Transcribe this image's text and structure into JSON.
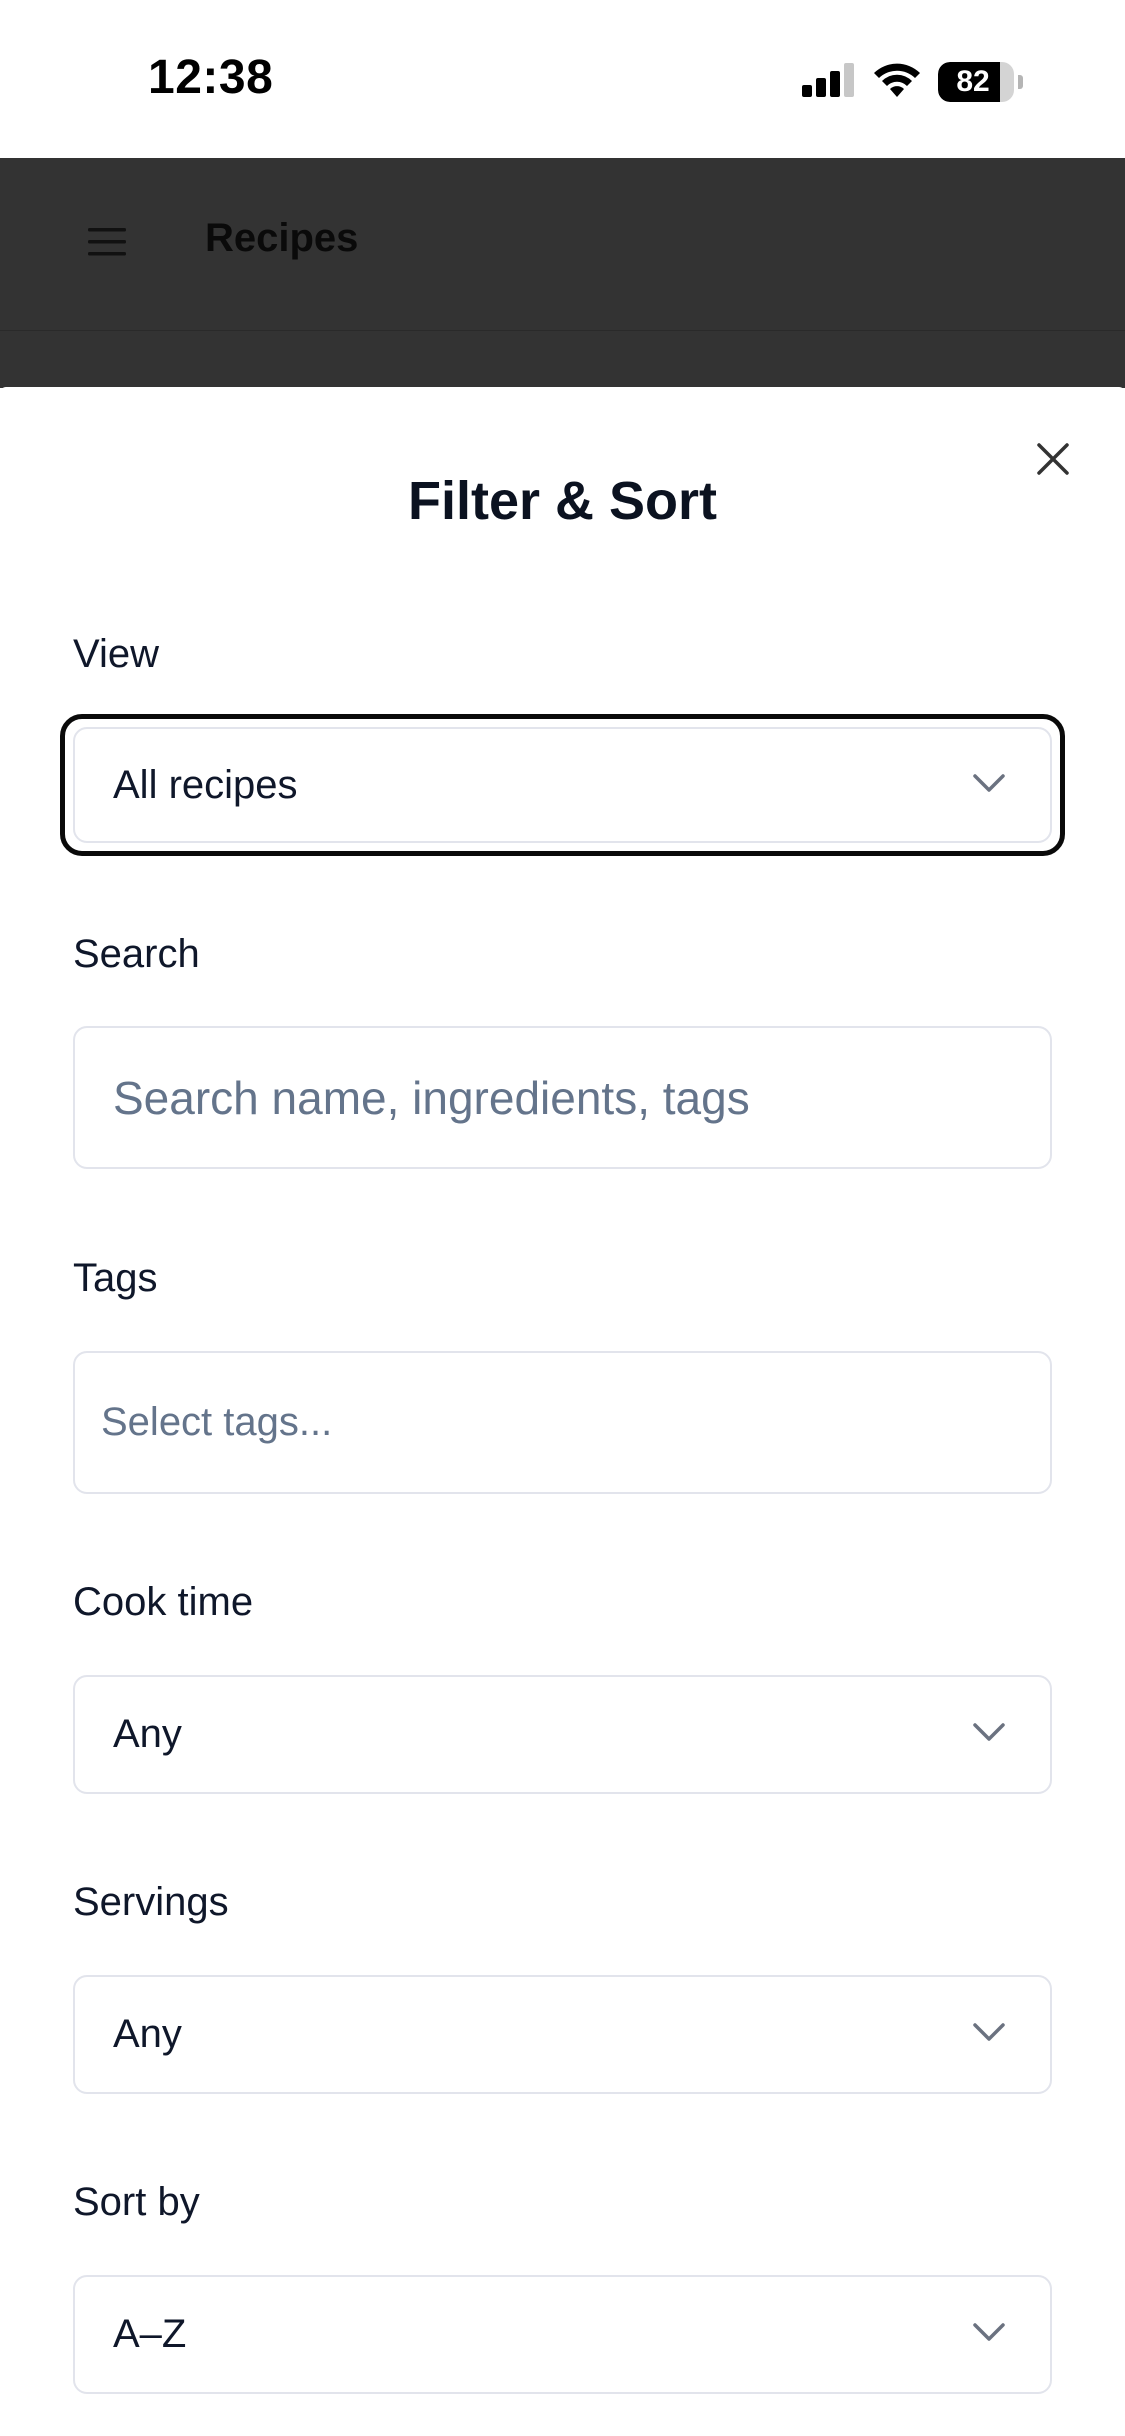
{
  "status_bar": {
    "time": "12:38",
    "battery_percent": 82,
    "icons": [
      "cellular-signal-icon",
      "wifi-icon",
      "battery-icon"
    ]
  },
  "app_header": {
    "menu_icon": "hamburger-menu-icon",
    "title": "Recipes"
  },
  "sheet": {
    "title": "Filter & Sort",
    "close_icon": "close-icon",
    "view": {
      "label": "View",
      "selected": "All recipes"
    },
    "search": {
      "label": "Search",
      "placeholder": "Search name, ingredients, tags",
      "value": ""
    },
    "tags": {
      "label": "Tags",
      "placeholder": "Select tags..."
    },
    "cook_time": {
      "label": "Cook time",
      "selected": "Any"
    },
    "servings": {
      "label": "Servings",
      "selected": "Any"
    },
    "sort_by": {
      "label": "Sort by",
      "selected": "A–Z"
    }
  },
  "colors": {
    "header_bg": "#333333",
    "border": "#e2e4ec",
    "placeholder": "#64748b",
    "text": "#0f172a",
    "focus_ring": "#0a0a0a"
  }
}
